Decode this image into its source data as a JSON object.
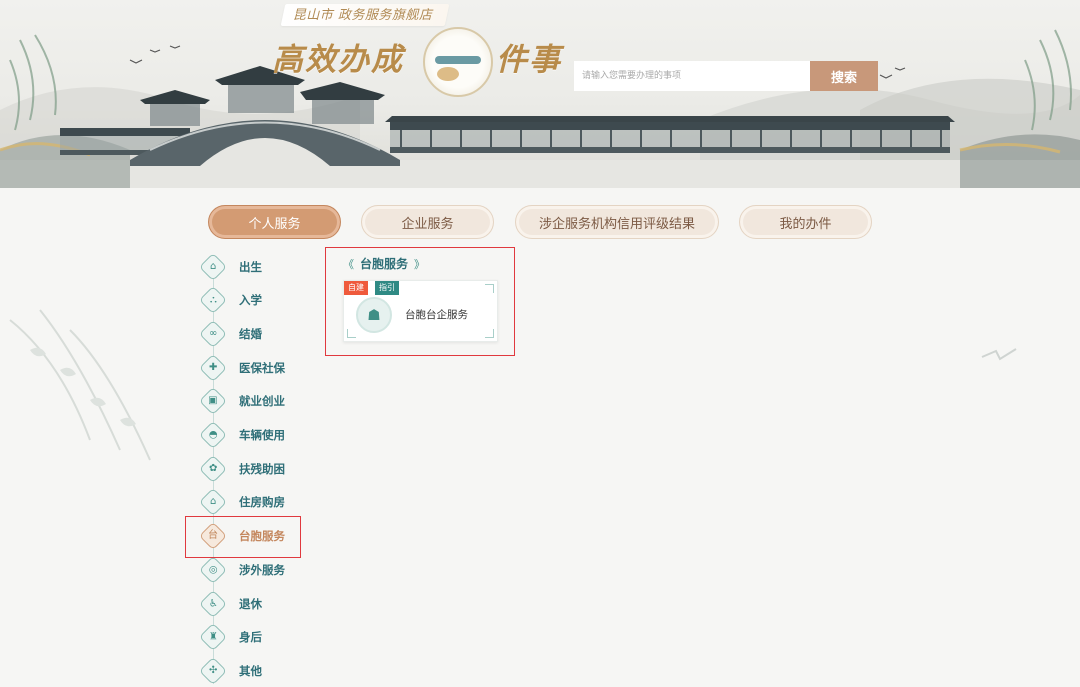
{
  "banner": {
    "shop_tag": "昆山市 政务服务旗舰店",
    "headline_left": "高效办成",
    "headline_right": "件事",
    "search_placeholder": "请输入您需要办理的事项",
    "search_button": "搜索"
  },
  "tabs": [
    {
      "label": "个人服务",
      "active": true
    },
    {
      "label": "企业服务",
      "active": false
    },
    {
      "label": "涉企服务机构信用评级结果",
      "active": false
    },
    {
      "label": "我的办件",
      "active": false
    }
  ],
  "sidebar": {
    "items": [
      {
        "label": "出生",
        "icon": "house-icon",
        "glyph": "⌂"
      },
      {
        "label": "入学",
        "icon": "school-icon",
        "glyph": "⛬"
      },
      {
        "label": "结婚",
        "icon": "rings-icon",
        "glyph": "∞"
      },
      {
        "label": "医保社保",
        "icon": "shield-icon",
        "glyph": "✚"
      },
      {
        "label": "就业创业",
        "icon": "briefcase-icon",
        "glyph": "▣"
      },
      {
        "label": "车辆使用",
        "icon": "car-icon",
        "glyph": "◓"
      },
      {
        "label": "扶残助困",
        "icon": "helping-hand-icon",
        "glyph": "✿"
      },
      {
        "label": "住房购房",
        "icon": "building-icon",
        "glyph": "⌂"
      },
      {
        "label": "台胞服务",
        "icon": "taiwan-icon",
        "glyph": "台",
        "active": true
      },
      {
        "label": "涉外服务",
        "icon": "globe-icon",
        "glyph": "◎"
      },
      {
        "label": "退休",
        "icon": "wheelchair-icon",
        "glyph": "♿"
      },
      {
        "label": "身后",
        "icon": "candle-icon",
        "glyph": "♜"
      },
      {
        "label": "其他",
        "icon": "grid-icon",
        "glyph": "✣"
      }
    ]
  },
  "panel": {
    "title": "台胞服务",
    "card": {
      "tag_red": "自建",
      "tag_teal": "指引",
      "label": "台胞台企服务",
      "icon": "people-icon"
    }
  },
  "colors": {
    "accent_tan": "#d39b73",
    "teal": "#2f6f78",
    "highlight_red": "#e0393e",
    "search_button": "#c8987a",
    "headline_gold": "#b88b4a"
  }
}
